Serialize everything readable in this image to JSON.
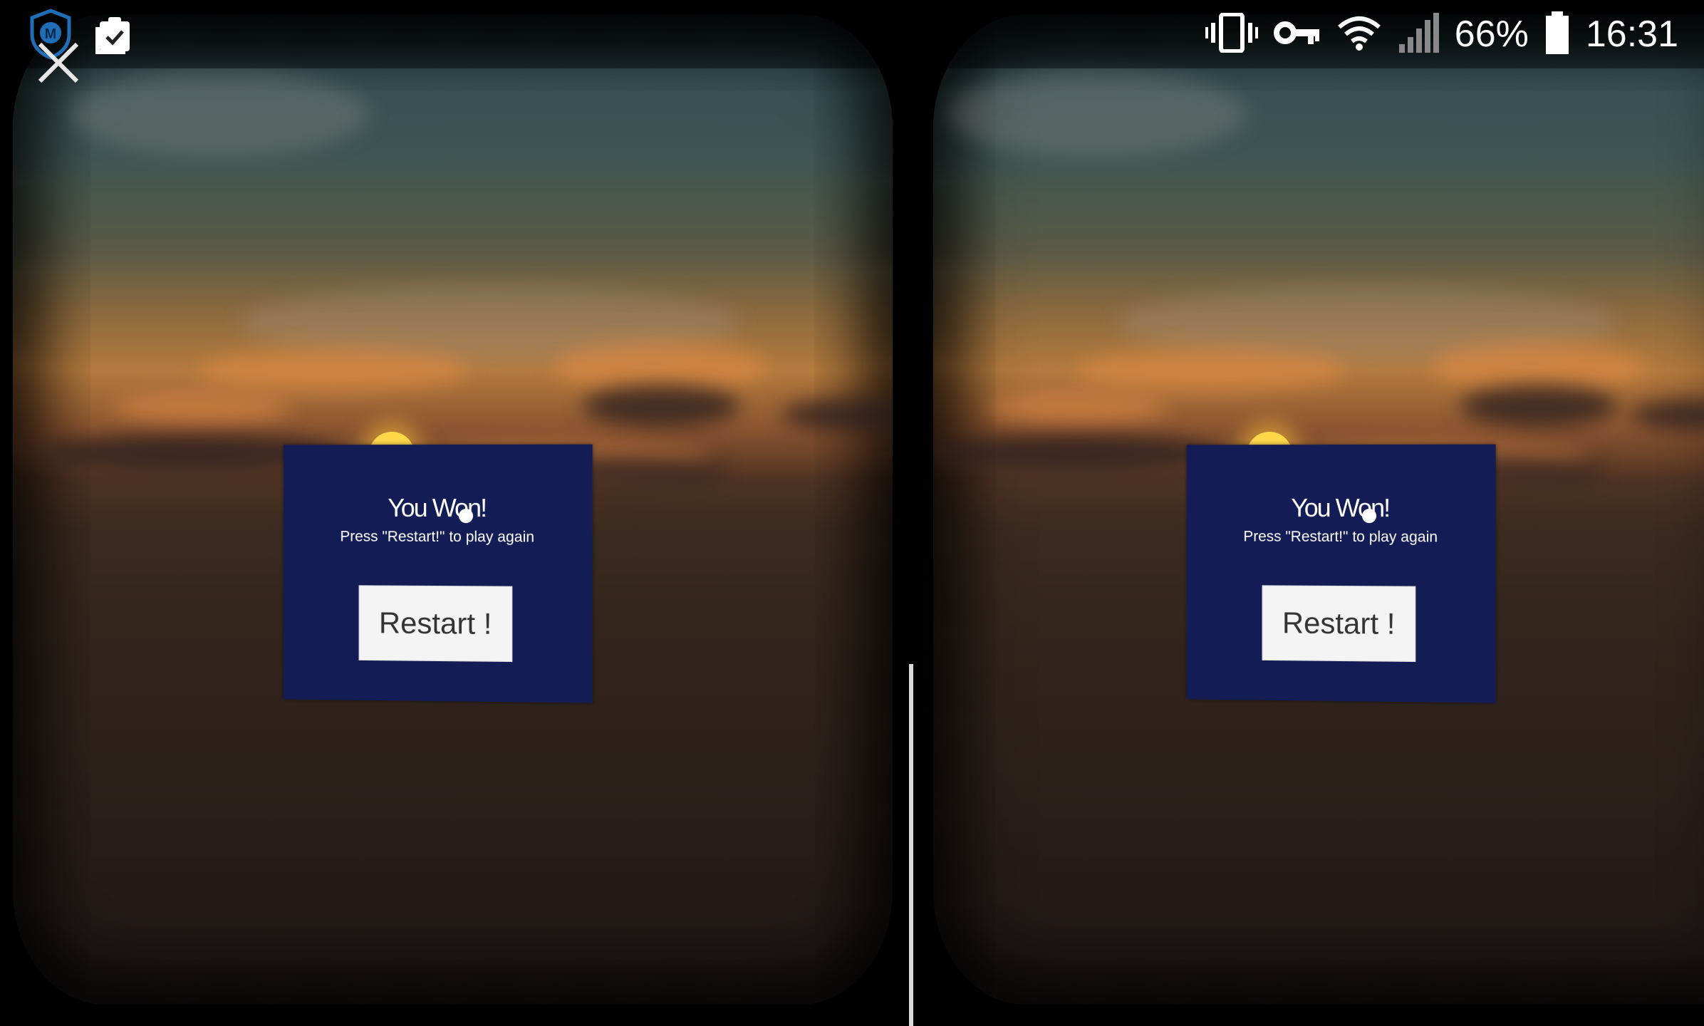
{
  "status_bar": {
    "battery_percent": "66%",
    "time": "16:31",
    "icons": [
      "shield-app-icon",
      "clipboard-check-icon",
      "vibrate-icon",
      "vpn-key-icon",
      "wifi-icon",
      "signal-icon",
      "battery-icon"
    ]
  },
  "vr": {
    "close_icon": "close-icon",
    "left_eye": {
      "title": "You Won!",
      "subtitle": "Press \"Restart!\" to play  again",
      "button_label": "Restart !"
    },
    "right_eye": {
      "title": "You Won!",
      "subtitle": "Press \"Restart!\" to play  again",
      "button_label": "Restart !"
    }
  },
  "colors": {
    "panel": "#141c55",
    "button": "#f4f4f4",
    "sun": "#ffd84a"
  }
}
